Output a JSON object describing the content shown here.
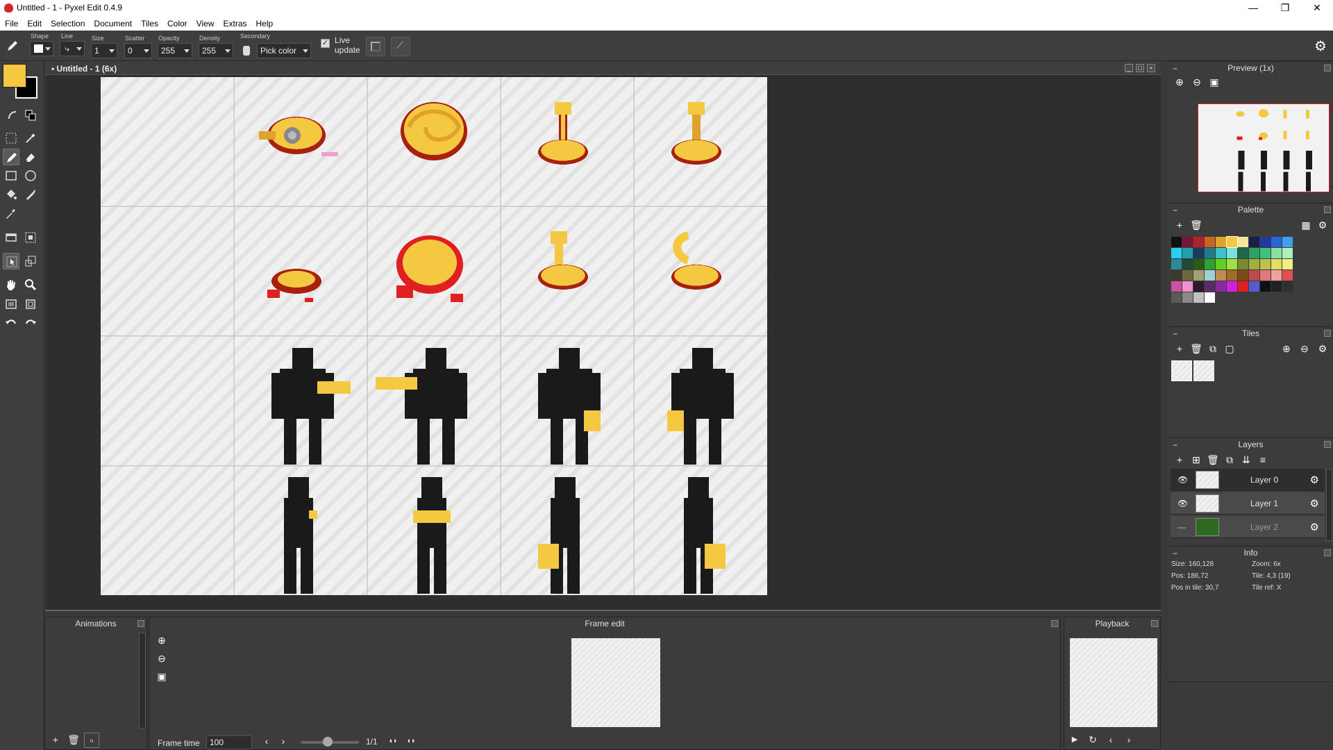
{
  "window": {
    "title": "Untitled - 1 - Pyxel Edit 0.4.9",
    "min": "—",
    "max": "❐",
    "close": "✕"
  },
  "menu": [
    "File",
    "Edit",
    "Selection",
    "Document",
    "Tiles",
    "Color",
    "View",
    "Extras",
    "Help"
  ],
  "options": {
    "shape_label": "Shape",
    "line_label": "Line",
    "size_label": "Size",
    "size_value": "1",
    "scatter_label": "Scatter",
    "scatter_value": "0",
    "opacity_label": "Opacity",
    "opacity_value": "255",
    "density_label": "Density",
    "density_value": "255",
    "secondary_label": "Secondary",
    "secondary_value": "Pick color",
    "live_update_line1": "Live",
    "live_update_line2": "update"
  },
  "colors": {
    "primary": "#f5c842",
    "secondary": "#000000",
    "accent_red": "#e02020"
  },
  "document": {
    "tab_title": "• Untitled - 1   (6x)"
  },
  "animations": {
    "title": "Animations"
  },
  "frame_edit": {
    "title": "Frame edit",
    "frame_time_label": "Frame time",
    "frame_time_value": "100",
    "frame_count": "1/1"
  },
  "playback": {
    "title": "Playback"
  },
  "preview": {
    "title": "Preview (1x)"
  },
  "palette": {
    "title": "Palette",
    "swatches": [
      "#111111",
      "#7a1438",
      "#b0222a",
      "#c7661f",
      "#e0a22a",
      "#f5c842",
      "#f7e39a",
      "#1a1f4a",
      "#1f3aa0",
      "#2a63d8",
      "#3fa0f0",
      "#2ad0f0",
      "#22a0b0",
      "#1a3a5a",
      "#207a8a",
      "#40c0c8",
      "#7ae0e0",
      "#1a6a4a",
      "#30a060",
      "#40c080",
      "#8ae0a0",
      "#b0f0c0",
      "#2a8a9a",
      "#1f4a3a",
      "#2a5a1a",
      "#30a030",
      "#60d020",
      "#a0e040",
      "#7a8a30",
      "#a0b040",
      "#c0c050",
      "#e0e060",
      "#f0f080",
      "#3a3a2a",
      "#6a6a3a",
      "#a0a070",
      "#a0d0d0",
      "#c08a50",
      "#a06a2a",
      "#7a4a1a",
      "#c04a4a",
      "#e07a7a",
      "#f0a0a0",
      "#e05050",
      "#d050a0",
      "#f090d0",
      "#2a1a2a",
      "#5a2a6a",
      "#8a2aa0",
      "#d020e0",
      "#e02020",
      "#5a5ad0",
      "#101010",
      "#202020",
      "#303030",
      "#5a5a5a",
      "#8a8a8a",
      "#c0c0c0",
      "#ffffff"
    ]
  },
  "tiles": {
    "title": "Tiles"
  },
  "layers": {
    "title": "Layers",
    "items": [
      {
        "name": "Layer 0",
        "visible": "👁"
      },
      {
        "name": "Layer 1",
        "visible": "👁"
      },
      {
        "name": "Layer 2",
        "visible": "—"
      }
    ]
  },
  "info": {
    "title": "Info",
    "size": "Size: 160,128",
    "zoom": "Zoom: 6x",
    "pos": "Pos: 186,72",
    "tile": "Tile: 4,3 (19)",
    "pos_in_tile": "Pos in tile: 30,7",
    "tile_ref": "Tile ref: X"
  }
}
